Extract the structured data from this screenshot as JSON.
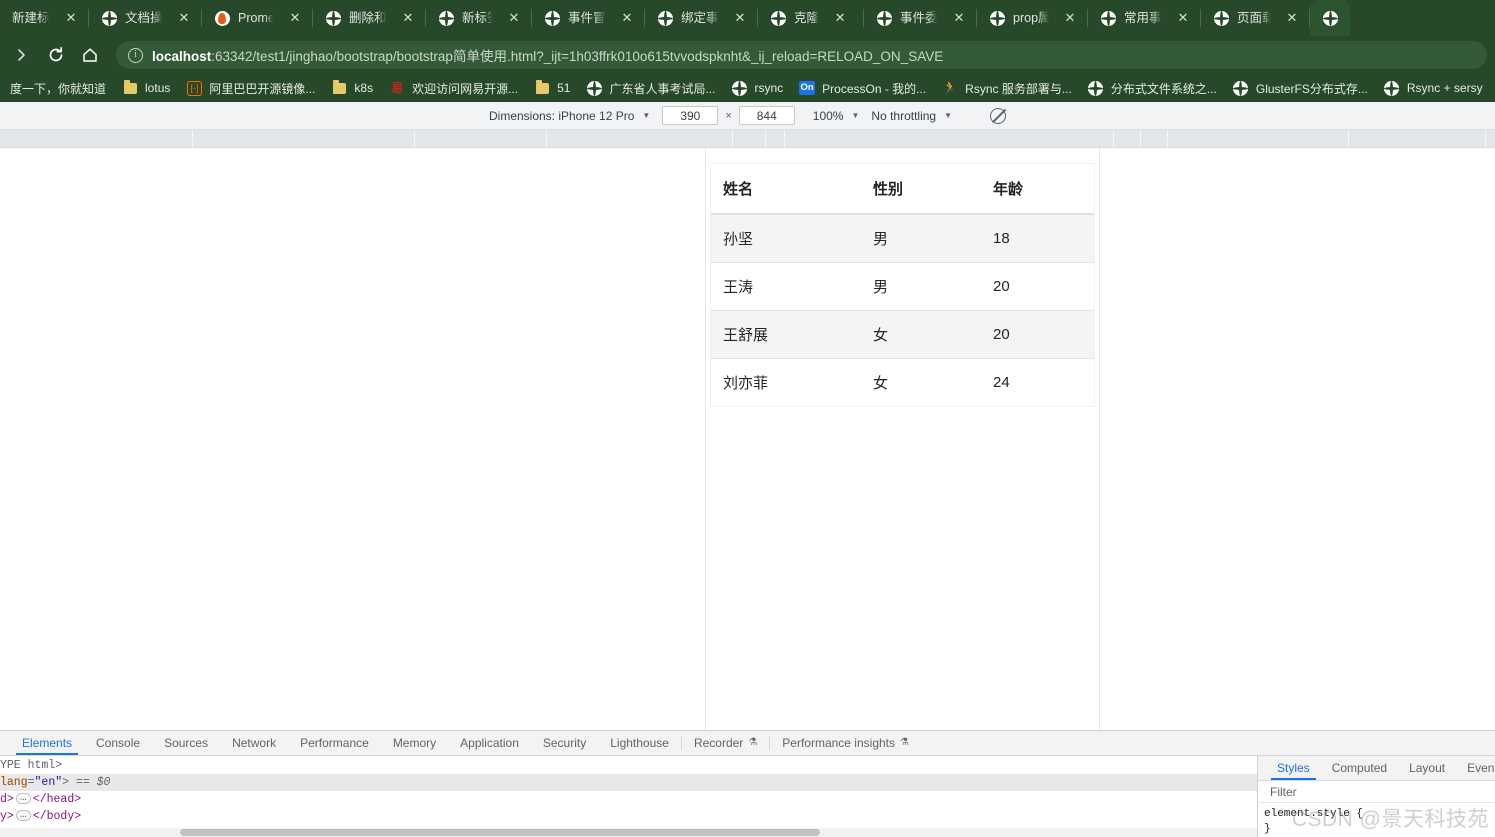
{
  "browser": {
    "tabs": [
      {
        "title": "新建标签",
        "favicon": "none",
        "active": false,
        "clipped_left": true
      },
      {
        "title": "文档操作",
        "favicon": "globe-icon",
        "active": false
      },
      {
        "title": "Prometheus",
        "favicon": "prometheus-icon",
        "active": false
      },
      {
        "title": "删除和清空",
        "favicon": "globe-icon",
        "active": false
      },
      {
        "title": "新标签页",
        "favicon": "globe-icon",
        "active": false
      },
      {
        "title": "事件冒泡",
        "favicon": "globe-icon",
        "active": false
      },
      {
        "title": "绑定事件的",
        "favicon": "globe-icon",
        "active": false
      },
      {
        "title": "克隆",
        "favicon": "globe-icon",
        "active": false
      },
      {
        "title": "事件委托",
        "favicon": "globe-icon",
        "active": false
      },
      {
        "title": "prop属性操",
        "favicon": "globe-icon",
        "active": false
      },
      {
        "title": "常用事件",
        "favicon": "globe-icon",
        "active": false
      },
      {
        "title": "页面载入",
        "favicon": "globe-icon",
        "active": false
      },
      {
        "title": "",
        "favicon": "globe-icon",
        "active": true,
        "clipped_right": true
      }
    ],
    "tab_close_label": "✕",
    "nav": {
      "back_label": "⟩",
      "reload_label": "⟳",
      "home_label": "⌂",
      "info_label": "i"
    },
    "omnibox": {
      "host": "localhost",
      "rest": ":63342/test1/jinghao/bootstrap/bootstrap简单使用.html?_ijt=1h03ffrk010o615tvvodspknht&_ij_reload=RELOAD_ON_SAVE"
    },
    "bookmarks": [
      {
        "label": "度一下，你就知道",
        "icon": "none",
        "clipped": true
      },
      {
        "label": "lotus",
        "icon": "folder-icon"
      },
      {
        "label": "阿里巴巴开源镜像...",
        "icon": "alibaba-icon"
      },
      {
        "label": "k8s",
        "icon": "folder-icon"
      },
      {
        "label": "欢迎访问网易开源...",
        "icon": "netease-icon"
      },
      {
        "label": "51",
        "icon": "folder-icon"
      },
      {
        "label": "广东省人事考试局...",
        "icon": "globe-icon"
      },
      {
        "label": "rsync",
        "icon": "globe-icon"
      },
      {
        "label": "ProcessOn - 我的...",
        "icon": "processon-icon"
      },
      {
        "label": "Rsync 服务部署与...",
        "icon": "runner-icon"
      },
      {
        "label": "分布式文件系统之...",
        "icon": "globe-icon"
      },
      {
        "label": "GlusterFS分布式存...",
        "icon": "globe-icon"
      },
      {
        "label": "Rsync + sersy",
        "icon": "globe-icon",
        "clipped": true
      }
    ]
  },
  "device_toolbar": {
    "dimensions_label": "Dimensions: iPhone 12 Pro",
    "width": "390",
    "height": "844",
    "times_symbol": "×",
    "zoom": "100%",
    "throttling": "No throttling",
    "caret": "▼",
    "rotate_icon_name": "rotate-device-icon"
  },
  "page": {
    "table": {
      "headers": [
        "姓名",
        "性别",
        "年龄"
      ],
      "rows": [
        {
          "name": "孙坚",
          "gender": "男",
          "age": "18"
        },
        {
          "name": "王涛",
          "gender": "男",
          "age": "20"
        },
        {
          "name": "王舒展",
          "gender": "女",
          "age": "20"
        },
        {
          "name": "刘亦菲",
          "gender": "女",
          "age": "24"
        }
      ]
    }
  },
  "devtools": {
    "tabs": [
      {
        "label": "Elements",
        "selected": true
      },
      {
        "label": "Console",
        "selected": false
      },
      {
        "label": "Sources",
        "selected": false
      },
      {
        "label": "Network",
        "selected": false
      },
      {
        "label": "Performance",
        "selected": false
      },
      {
        "label": "Memory",
        "selected": false
      },
      {
        "label": "Application",
        "selected": false
      },
      {
        "label": "Security",
        "selected": false
      },
      {
        "label": "Lighthouse",
        "selected": false
      },
      {
        "label": "Recorder",
        "selected": false,
        "badge": "⚗"
      },
      {
        "label": "Performance insights",
        "selected": false,
        "badge": "⚗"
      }
    ],
    "dom_lines": [
      {
        "text": "YPE html>",
        "kind": "doctype",
        "selected": false
      },
      {
        "text": "lang=\"en\"> == $0",
        "kind": "html",
        "selected": true
      },
      {
        "text": "d> … </head>",
        "kind": "head",
        "selected": false
      },
      {
        "text": "y> … </body>",
        "kind": "body",
        "selected": false
      }
    ],
    "sidebar": {
      "tabs": [
        {
          "label": "Styles",
          "selected": true
        },
        {
          "label": "Computed",
          "selected": false
        },
        {
          "label": "Layout",
          "selected": false
        },
        {
          "label": "Event Li",
          "selected": false
        }
      ],
      "filter_placeholder": "Filter",
      "rule_selector": "element.style {",
      "rule_close": "}"
    }
  },
  "watermark": "CSDN @景天科技苑",
  "colors": {
    "chrome_green": "#28482a",
    "chrome_green_active": "#2d5431",
    "omnibox_green": "#345a37",
    "devtools_accent": "#1a73e8",
    "table_stripe": "#f4f4f5",
    "table_border": "#dee2e6"
  }
}
